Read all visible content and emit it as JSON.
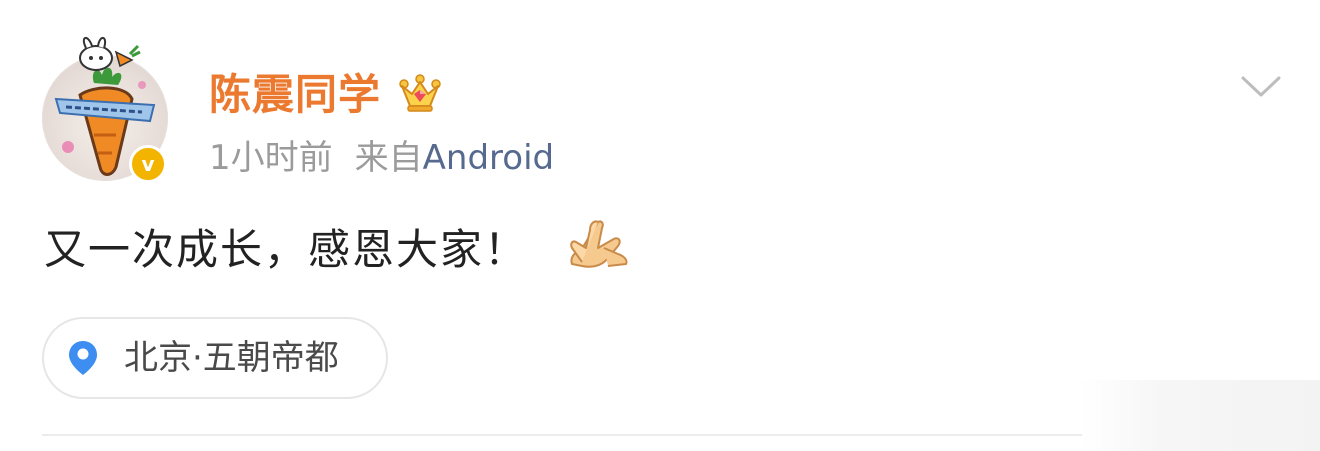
{
  "post": {
    "username": "陈震同学",
    "time_ago": "1小时前",
    "source_prefix": "来自",
    "source_name": "Android",
    "text": "又一次成长，感恩大家！",
    "location": "北京·五朝帝都"
  },
  "icons": {
    "avatar": "carrot-avatar",
    "verified": "verified-badge-icon",
    "vip": "crown-icon",
    "menu": "chevron-down-icon",
    "emoji": "folded-hands-icon",
    "location": "location-pin-icon"
  },
  "colors": {
    "username": "#eb7a30",
    "source_link": "#56698f",
    "meta_gray": "#9b9b9b",
    "verified_badge": "#f3b400",
    "location_pin": "#3d8ef0"
  },
  "badge_letter": "v"
}
